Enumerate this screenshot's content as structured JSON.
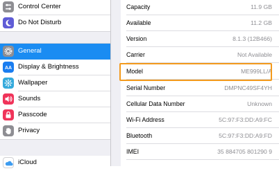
{
  "sidebar": {
    "items": [
      {
        "label": "Control Center",
        "icon": "control-center-icon"
      },
      {
        "label": "Do Not Disturb",
        "icon": "moon-icon"
      },
      {
        "label": "General",
        "icon": "gear-icon",
        "selected": true
      },
      {
        "label": "Display & Brightness",
        "icon": "display-brightness-icon"
      },
      {
        "label": "Wallpaper",
        "icon": "wallpaper-icon"
      },
      {
        "label": "Sounds",
        "icon": "speaker-icon"
      },
      {
        "label": "Passcode",
        "icon": "lock-icon"
      },
      {
        "label": "Privacy",
        "icon": "hand-icon"
      },
      {
        "label": "iCloud",
        "icon": "cloud-icon"
      }
    ]
  },
  "about": {
    "rows": [
      {
        "label": "Capacity",
        "value": "11.9 GB"
      },
      {
        "label": "Available",
        "value": "11.2 GB"
      },
      {
        "label": "Version",
        "value": "8.1.3 (12B466)"
      },
      {
        "label": "Carrier",
        "value": "Not Available"
      },
      {
        "label": "Model",
        "value": "ME999LL/A"
      },
      {
        "label": "Serial Number",
        "value": "DMPNC49SF4YH"
      },
      {
        "label": "Cellular Data Number",
        "value": "Unknown"
      },
      {
        "label": "Wi-Fi Address",
        "value": "5C:97:F3:DD:A9:FC"
      },
      {
        "label": "Bluetooth",
        "value": "5C:97:F3:DD:A9:FD"
      },
      {
        "label": "IMEI",
        "value": "35 884705 801290 9"
      }
    ]
  },
  "colors": {
    "selection": "#1a8cf2",
    "highlight": "#f39a1c",
    "groupBackground": "#efeff4"
  }
}
